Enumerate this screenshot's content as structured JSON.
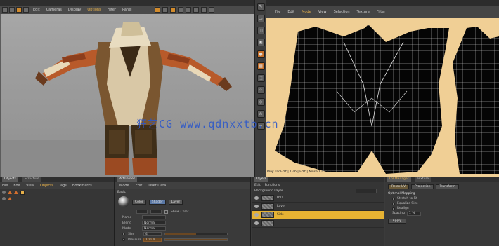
{
  "viewport": {
    "menu": [
      "Edit",
      "Cameras",
      "Display",
      "Options",
      "Filter",
      "Panel"
    ],
    "active_menu_index": 3
  },
  "uv_editor": {
    "menu": [
      "File",
      "Edit",
      "Mode",
      "View",
      "Selection",
      "Texture",
      "Filter"
    ],
    "active_menu_index": 2,
    "status_text": "Proj: UV Edit | 1 ch | Edit | Noise 1.0 | 0.2"
  },
  "watermark": "狂艺CG  www.qdnxxtb.cn",
  "bottom": {
    "objects": {
      "header_tabs": [
        "Objects",
        "Structure"
      ],
      "tabs": [
        "File",
        "Edit",
        "View",
        "Objects",
        "Tags",
        "Bookmarks"
      ],
      "active_tab_index": 3
    },
    "attributes": {
      "header": "Attributes",
      "tabs": [
        "Mode",
        "Edit",
        "User Data"
      ],
      "section": "Basic",
      "chips": [
        "Color",
        "Shader",
        "Layer"
      ],
      "checkbox_label": "Show Color",
      "rows": [
        {
          "label": "Name",
          "value": ""
        },
        {
          "label": "Blend",
          "value": "Normal"
        },
        {
          "label": "Mode",
          "value": "Normal"
        },
        {
          "label": "Size",
          "value": "4"
        },
        {
          "label": "Pressure",
          "value": "100 %"
        }
      ]
    },
    "layers": {
      "header": "Layers",
      "tabs": [
        "Edit",
        "Functions"
      ],
      "layer_set": "Background Layer",
      "items": [
        {
          "name": "UV1"
        },
        {
          "name": "Layer"
        },
        {
          "name": "Side"
        }
      ],
      "selected_index": 2
    },
    "properties": {
      "header_tabs": [
        "UV Manager",
        "Texture"
      ],
      "buttons": [
        "Relax UV",
        "Projection",
        "Transform"
      ],
      "section": "Optimal Mapping",
      "options": [
        "Stretch to Fit",
        "Equalize Size",
        "Realign"
      ],
      "spacing_label": "Spacing",
      "spacing_value": "1 %",
      "apply_label": "Apply"
    }
  },
  "colors": {
    "accent": "#e6b04a",
    "uv_background": "#f0cf95",
    "selected_layer": "#e6b233",
    "watermark": "#2d58c9"
  }
}
